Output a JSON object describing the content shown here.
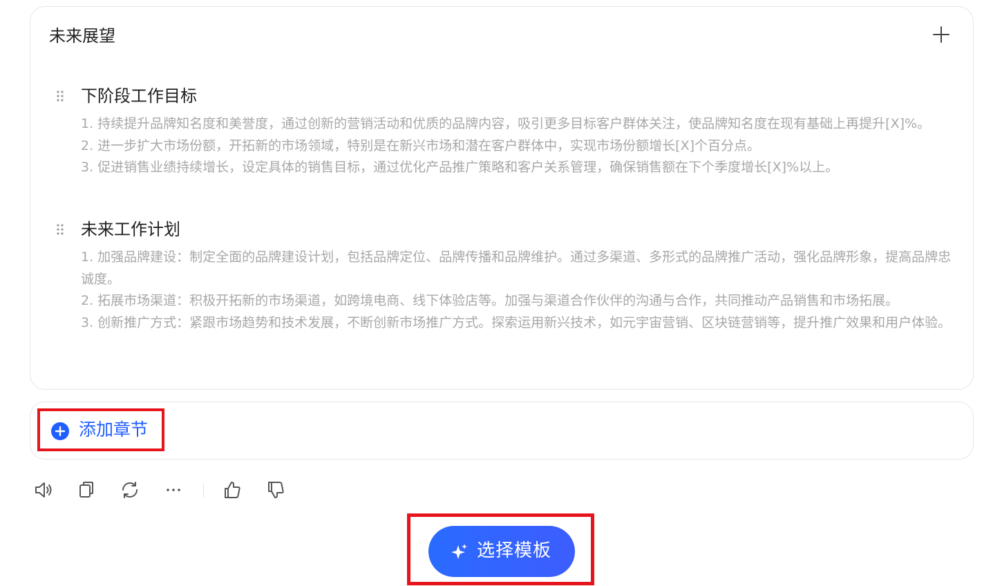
{
  "card": {
    "title": "未来展望",
    "sections": [
      {
        "title": "下阶段工作目标",
        "paragraphs": [
          "1. 持续提升品牌知名度和美誉度，通过创新的营销活动和优质的品牌内容，吸引更多目标客户群体关注，使品牌知名度在现有基础上再提升[X]%。",
          "2. 进一步扩大市场份额，开拓新的市场领域，特别是在新兴市场和潜在客户群体中，实现市场份额增长[X]个百分点。",
          "3. 促进销售业绩持续增长，设定具体的销售目标，通过优化产品推广策略和客户关系管理，确保销售额在下个季度增长[X]%以上。"
        ]
      },
      {
        "title": "未来工作计划",
        "paragraphs": [
          "1. 加强品牌建设：制定全面的品牌建设计划，包括品牌定位、品牌传播和品牌维护。通过多渠道、多形式的品牌推广活动，强化品牌形象，提高品牌忠诚度。",
          "2. 拓展市场渠道：积极开拓新的市场渠道，如跨境电商、线下体验店等。加强与渠道合作伙伴的沟通与合作，共同推动产品销售和市场拓展。",
          "3. 创新推广方式：紧跟市场趋势和技术发展，不断创新市场推广方式。探索运用新兴技术，如元宇宙营销、区块链营销等，提升推广效果和用户体验。"
        ]
      }
    ]
  },
  "add_chapter": {
    "label": "添加章节"
  },
  "toolbar": {
    "icons": [
      "speaker-icon",
      "copy-icon",
      "refresh-icon",
      "more-icon",
      "thumbs-up-icon",
      "thumbs-down-icon"
    ]
  },
  "template_button": {
    "label": "选择模板"
  },
  "colors": {
    "accent": "#1f5eff",
    "highlight_border": "#e8141c",
    "body_text": "#a8a8a8",
    "title_text": "#222222"
  }
}
